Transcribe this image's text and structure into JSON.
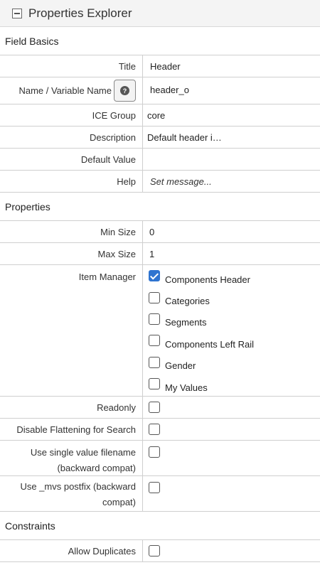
{
  "panel": {
    "title": "Properties Explorer",
    "collapse_icon": "minus-square-icon"
  },
  "field_basics": {
    "section_title": "Field Basics",
    "title_label": "Title",
    "title_value": "Header",
    "name_label": "Name / Variable Name",
    "name_value": "header_o",
    "name_help_icon": "question-circle-icon",
    "ice_group_label": "ICE Group",
    "ice_group_value": "core",
    "description_label": "Description",
    "description_value": "Default header i…",
    "default_value_label": "Default Value",
    "default_value_value": "",
    "help_label": "Help",
    "help_value": "Set message..."
  },
  "properties": {
    "section_title": "Properties",
    "min_size_label": "Min Size",
    "min_size_value": "0",
    "max_size_label": "Max Size",
    "max_size_value": "1",
    "item_manager_label": "Item Manager",
    "item_manager_options": [
      {
        "label": "Components Header",
        "checked": true
      },
      {
        "label": "Categories",
        "checked": false
      },
      {
        "label": "Segments",
        "checked": false
      },
      {
        "label": "Components Left Rail",
        "checked": false
      },
      {
        "label": "Gender",
        "checked": false
      },
      {
        "label": "My Values",
        "checked": false
      }
    ],
    "readonly_label": "Readonly",
    "readonly_checked": false,
    "disable_flattening_label": "Disable Flattening for Search",
    "disable_flattening_checked": false,
    "single_value_filename_label_1": "Use single value filename",
    "single_value_filename_label_2": "(backward compat)",
    "single_value_filename_checked": false,
    "mvs_postfix_label_1": "Use _mvs postfix (backward",
    "mvs_postfix_label_2": "compat)",
    "mvs_postfix_checked": false
  },
  "constraints": {
    "section_title": "Constraints",
    "allow_duplicates_label": "Allow Duplicates",
    "allow_duplicates_checked": false
  },
  "colors": {
    "accent": "#2f74d0",
    "header_bg": "#f4f4f4",
    "border": "#cfcfcf"
  }
}
